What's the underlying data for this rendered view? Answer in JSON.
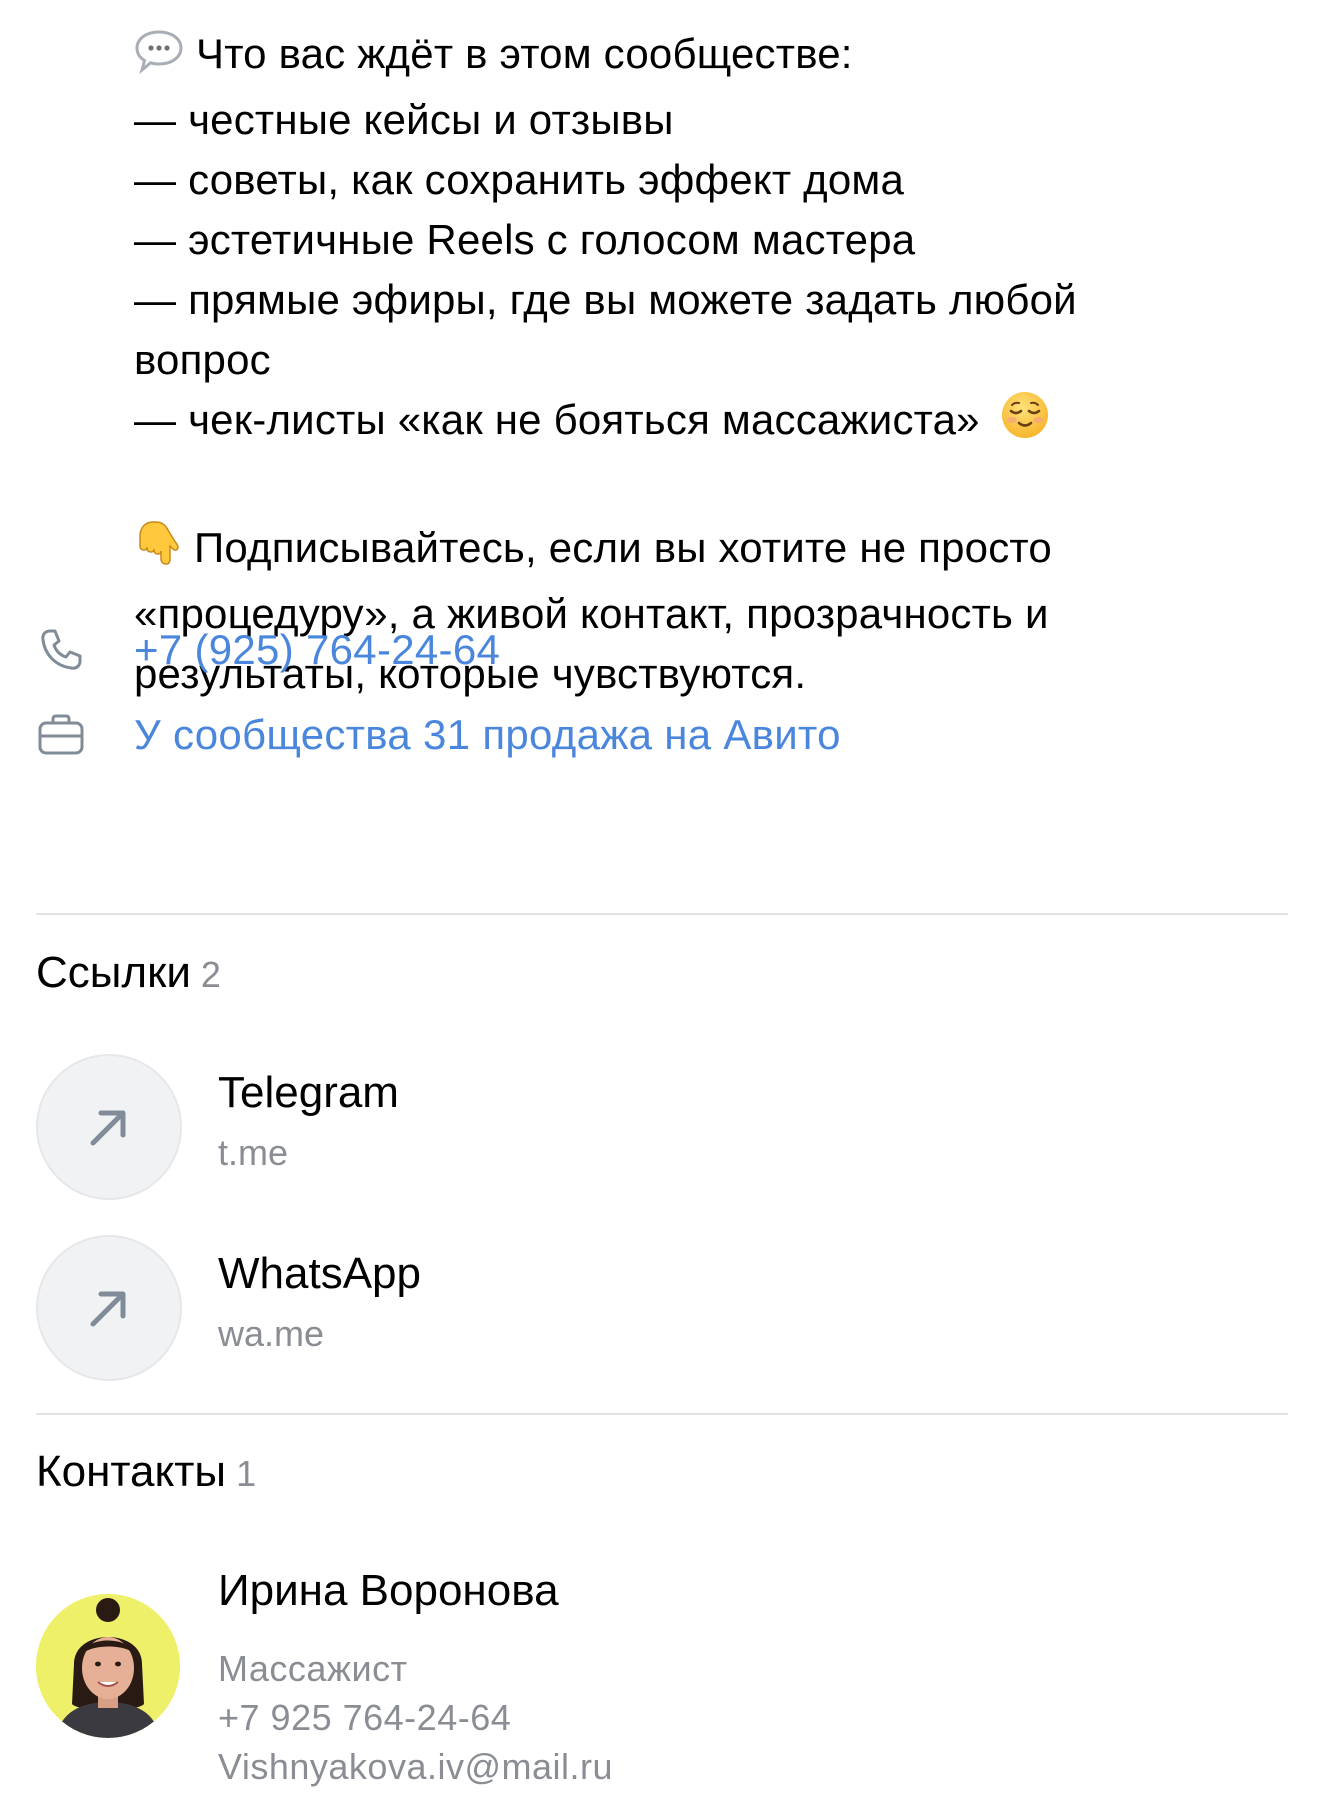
{
  "description": {
    "line1": "Что вас ждёт в этом сообществе:",
    "line2": "— честные кейсы и отзывы",
    "line3": "— советы, как сохранить эффект дома",
    "line4": "— эстетичные Reels с голосом мастера",
    "line5": "— прямые эфиры, где вы можете задать любой",
    "line6": "вопрос",
    "line7": "— чек-листы «как не бояться массажиста»",
    "line8": "Подписывайтесь, если вы хотите не просто",
    "line9": "«процедуру», а живой контакт, прозрачность и",
    "line10": "результаты, которые чувствуются.",
    "emojis": [
      "speech-bubble-emoji",
      "relieved-face-emoji",
      "pointing-down-emoji"
    ]
  },
  "info": {
    "phone": "+7 (925) 764-24-64",
    "sales": "У сообщества 31 продажа на Авито",
    "phone_icon": "phone-icon",
    "briefcase_icon": "briefcase-icon"
  },
  "links": {
    "title": "Ссылки",
    "count": "2",
    "items": [
      {
        "title": "Telegram",
        "domain": "t.me",
        "icon": "arrow-up-right-icon"
      },
      {
        "title": "WhatsApp",
        "domain": "wa.me",
        "icon": "arrow-up-right-icon"
      }
    ]
  },
  "contacts": {
    "title": "Контакты",
    "count": "1",
    "items": [
      {
        "name": "Ирина Воронова",
        "role": "Массажист",
        "phone": "+7 925 764-24-64",
        "email": "Vishnyakova.iv@mail.ru"
      }
    ]
  },
  "colors": {
    "link_blue": "#4a87dc",
    "secondary_text": "#8a8d93",
    "divider": "#e3e4e8",
    "circle_bg": "#f1f2f4",
    "avatar_bg": "#eef06a"
  }
}
